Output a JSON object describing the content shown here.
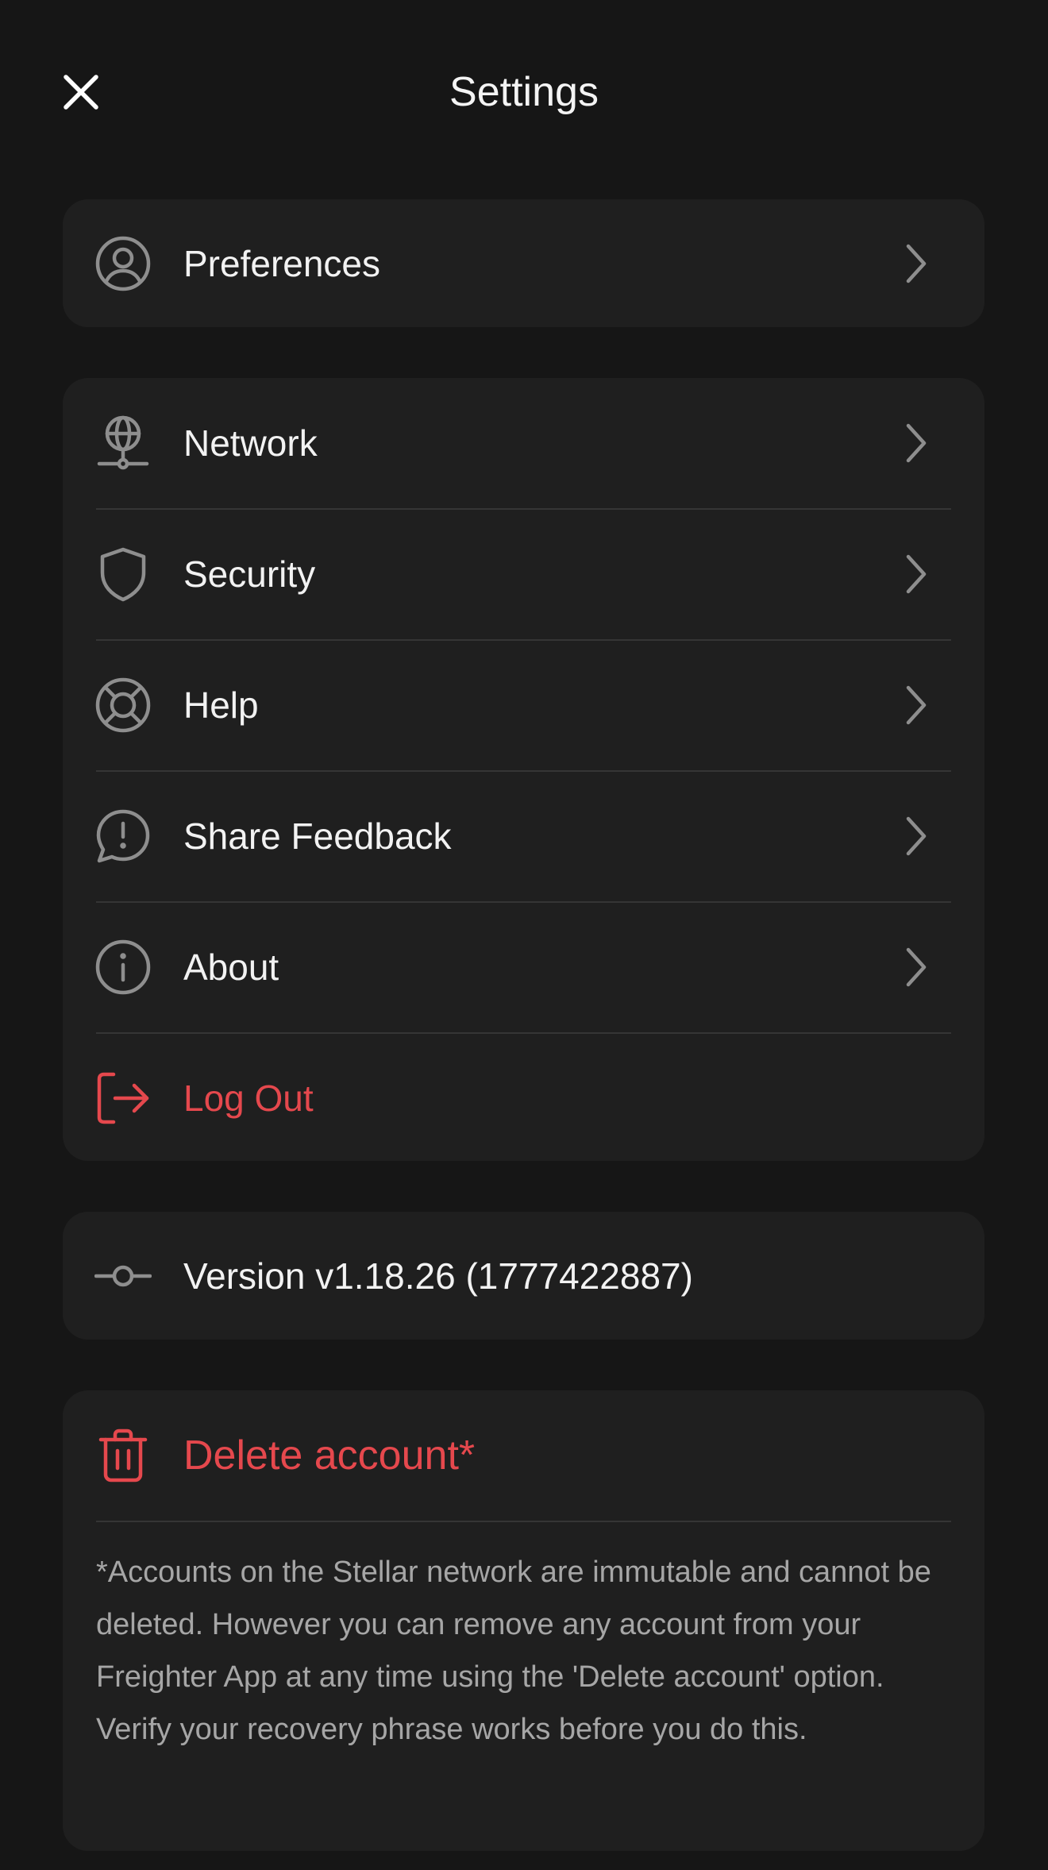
{
  "header": {
    "title": "Settings"
  },
  "groups": {
    "preferences": {
      "label": "Preferences"
    },
    "main": {
      "network": "Network",
      "security": "Security",
      "help": "Help",
      "feedback": "Share Feedback",
      "about": "About",
      "logout": "Log Out"
    },
    "version": {
      "label": "Version v1.18.26 (1777422887)"
    },
    "delete": {
      "label": "Delete account*",
      "note": "*Accounts on the Stellar network are immutable and cannot be deleted. However you can remove any account from your Freighter App at any time using the 'Delete account' option. Verify your recovery phrase works before you do this."
    }
  },
  "icons": {
    "close": "close-icon",
    "preferences": "user-circle-icon",
    "network": "globe-network-icon",
    "security": "shield-icon",
    "help": "lifebuoy-icon",
    "feedback": "message-alert-icon",
    "about": "info-circle-icon",
    "logout": "logout-icon",
    "version": "git-commit-icon",
    "delete": "trash-icon",
    "chevron": "chevron-right-icon"
  },
  "colors": {
    "background": "#161616",
    "card": "#1f1f1f",
    "text": "#f2f2f2",
    "muted": "#a6a6a6",
    "icon": "#8e8e8e",
    "danger": "#e5484d",
    "divider": "#353535"
  }
}
